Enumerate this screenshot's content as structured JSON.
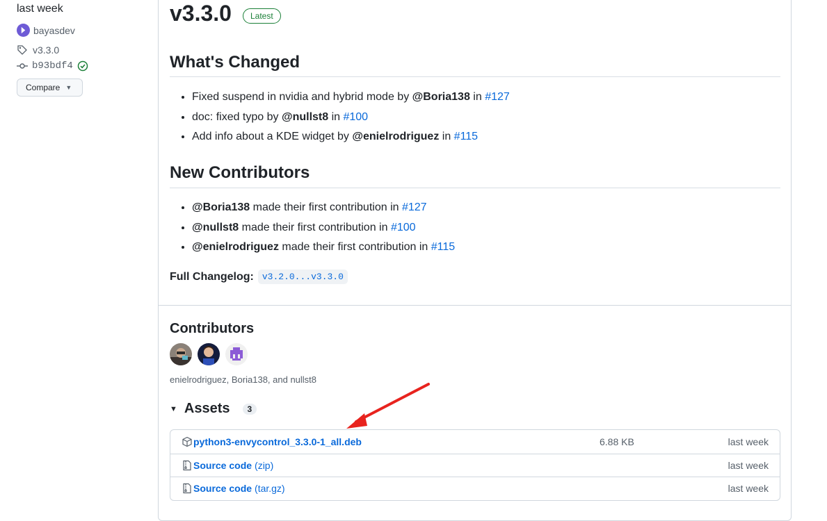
{
  "sidebar": {
    "date": "last week",
    "author": "bayasdev",
    "tag": "v3.3.0",
    "commit": "b93bdf4",
    "compare_label": "Compare"
  },
  "release": {
    "title": "v3.3.0",
    "badge": "Latest",
    "whats_changed_heading": "What's Changed",
    "changes": [
      {
        "text": "Fixed suspend in nvidia and hybrid mode by ",
        "user": "@Boria138",
        "in": " in ",
        "pr": "#127"
      },
      {
        "text": "doc: fixed typo by ",
        "user": "@nullst8",
        "in": " in ",
        "pr": "#100"
      },
      {
        "text": "Add info about a KDE widget by ",
        "user": "@enielrodriguez",
        "in": " in ",
        "pr": "#115"
      }
    ],
    "new_contributors_heading": "New Contributors",
    "new_contributors": [
      {
        "user": "@Boria138",
        "text": " made their first contribution in ",
        "pr": "#127"
      },
      {
        "user": "@nullst8",
        "text": " made their first contribution in ",
        "pr": "#100"
      },
      {
        "user": "@enielrodriguez",
        "text": " made their first contribution in ",
        "pr": "#115"
      }
    ],
    "changelog_label": "Full Changelog",
    "changelog_colon": ":",
    "changelog_range": "v3.2.0...v3.3.0"
  },
  "contributors": {
    "heading": "Contributors",
    "names": "enielrodriguez, Boria138, and nullst8"
  },
  "assets": {
    "heading": "Assets",
    "count": "3",
    "items": [
      {
        "name": "python3-envycontrol_3.3.0-1_all.deb",
        "ext": "",
        "size": "6.88 KB",
        "date": "last week",
        "icon": "package-icon"
      },
      {
        "name": "Source code",
        "ext": "(zip)",
        "size": "",
        "date": "last week",
        "icon": "file-zip-icon"
      },
      {
        "name": "Source code",
        "ext": "(tar.gz)",
        "size": "",
        "date": "last week",
        "icon": "file-zip-icon"
      }
    ]
  },
  "colors": {
    "link": "#0969da",
    "latest_badge": "#1a7f37",
    "annotation_arrow": "#e8231e"
  }
}
